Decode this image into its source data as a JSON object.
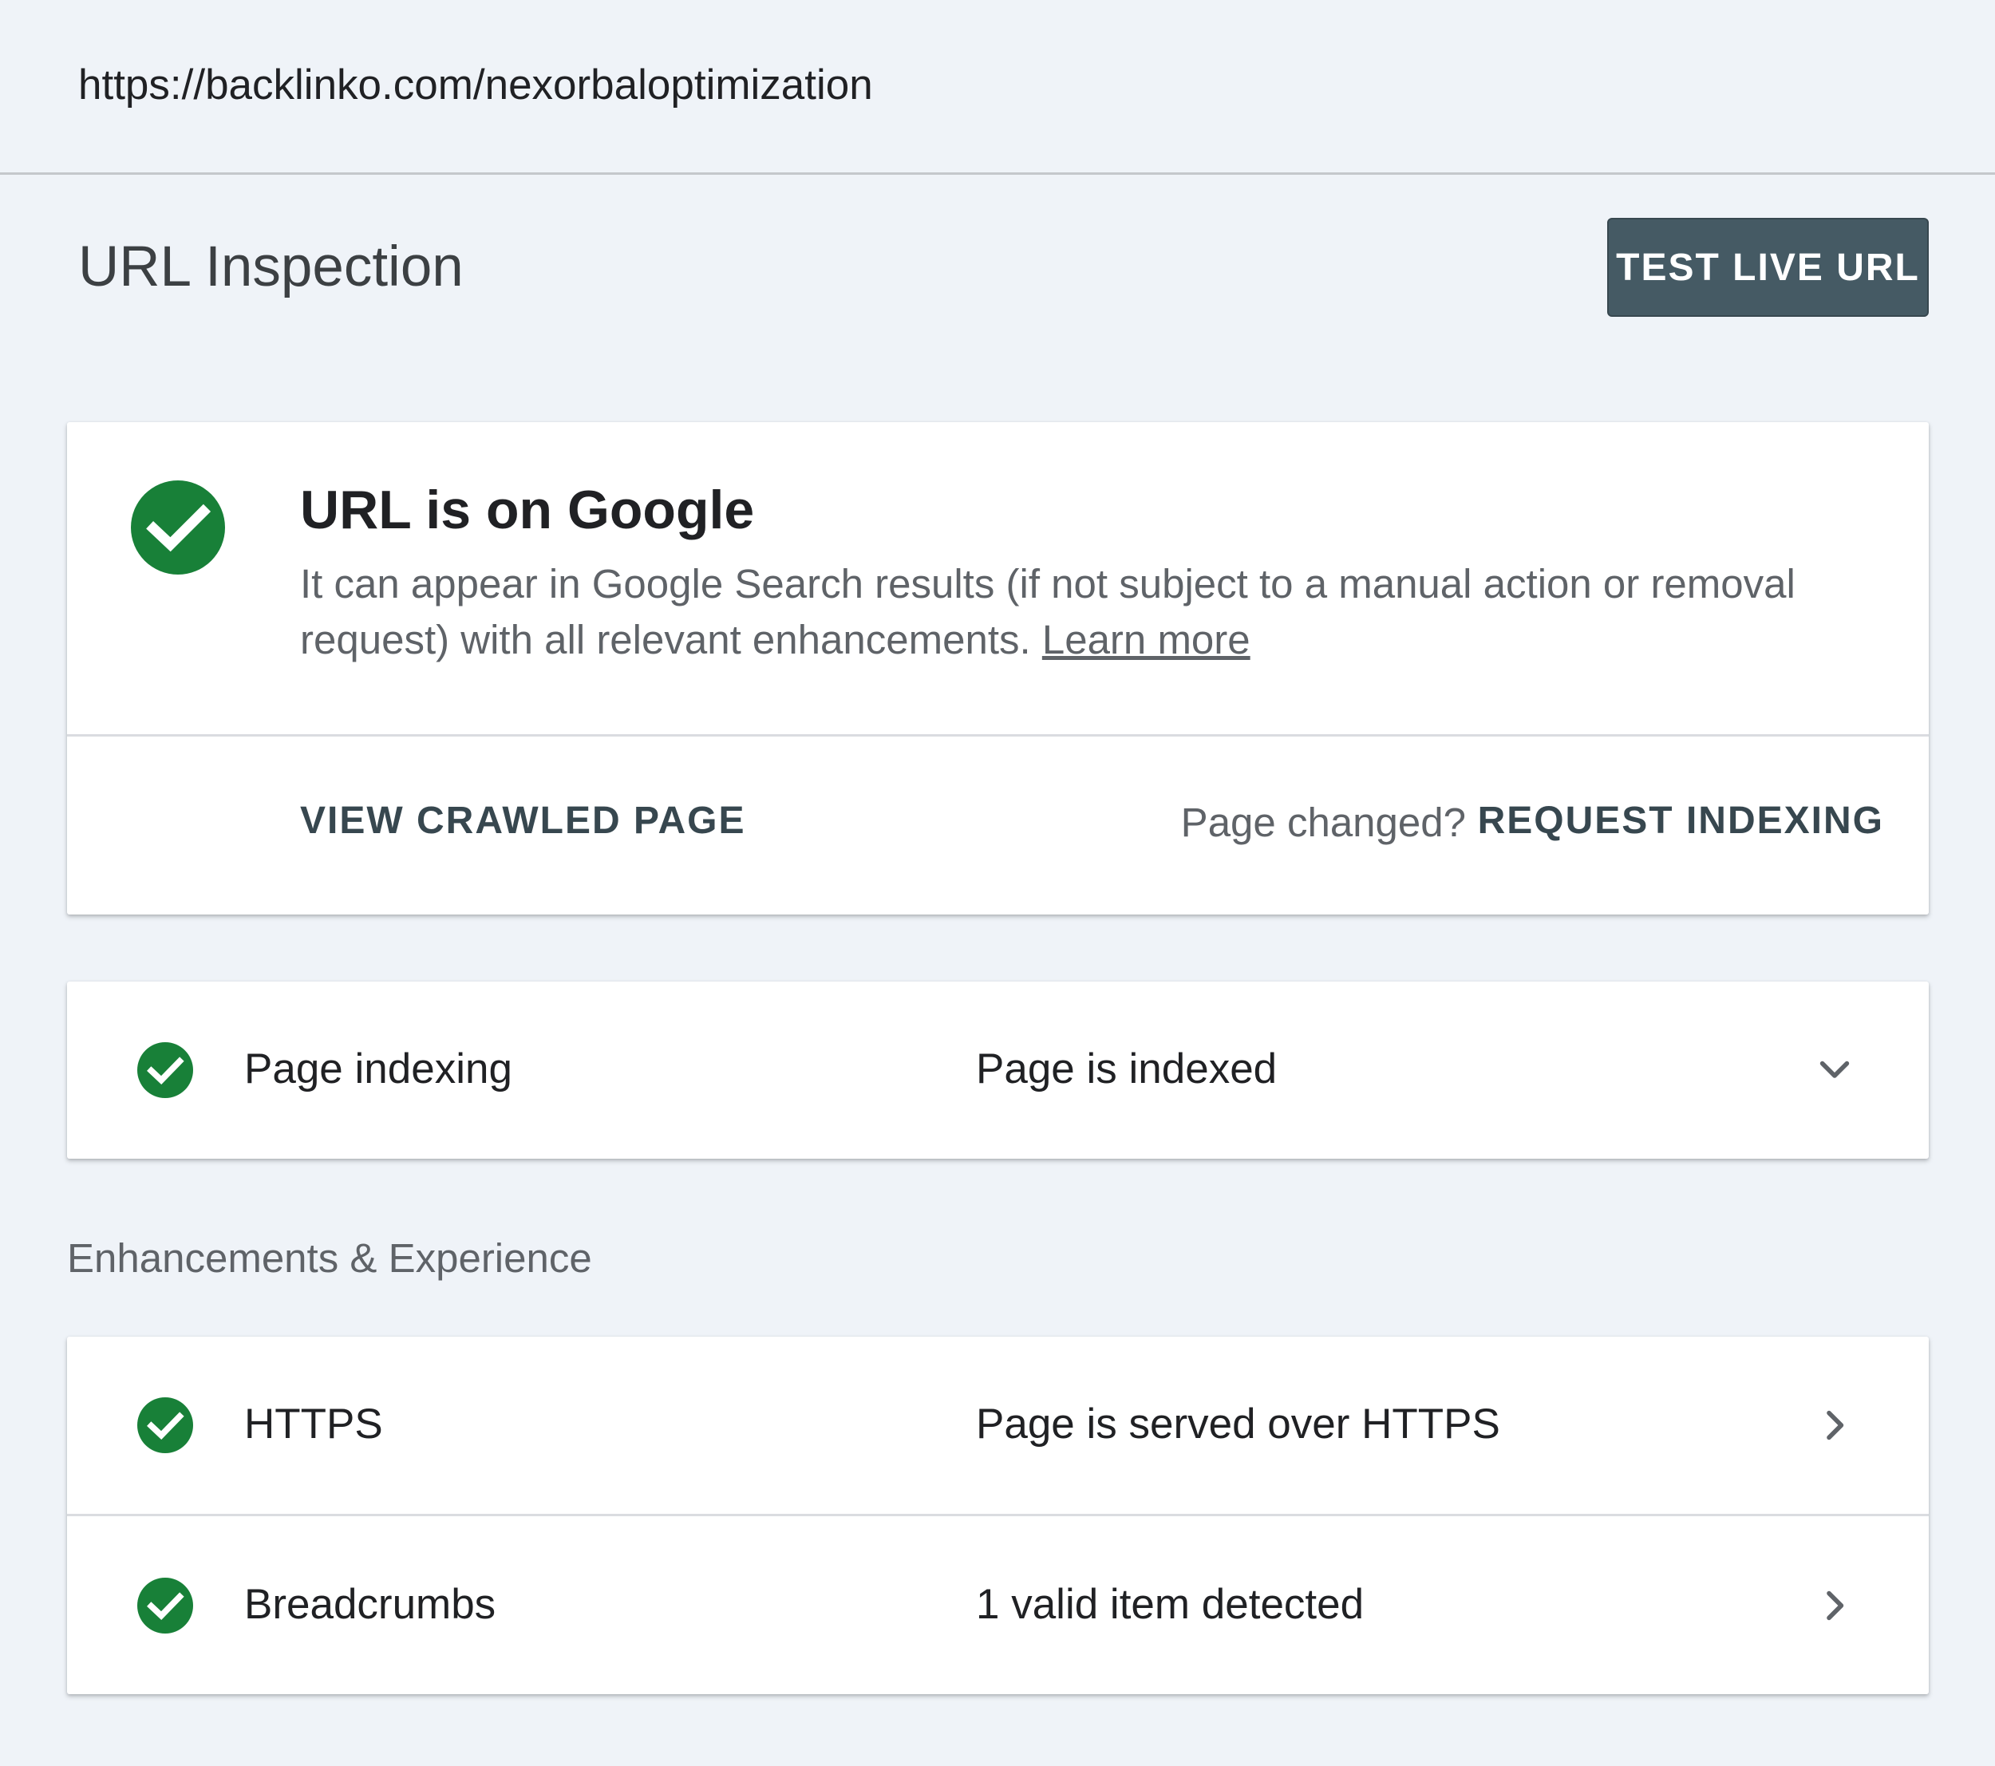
{
  "url_bar": {
    "url": "https://backlinko.com/nexorbaloptimization"
  },
  "header": {
    "title": "URL Inspection",
    "test_live_url_label": "TEST LIVE URL"
  },
  "status_card": {
    "title": "URL is on Google",
    "description": "It can appear in Google Search results (if not subject to a manual action or removal request) with all relevant enhancements.",
    "learn_more_label": "Learn more",
    "view_crawled_label": "VIEW CRAWLED PAGE",
    "page_changed_text": "Page changed?",
    "request_indexing_label": "REQUEST INDEXING",
    "status_icon": "check-circle-icon"
  },
  "indexing": {
    "label": "Page indexing",
    "value": "Page is indexed",
    "icon": "check-circle-icon",
    "toggle_icon": "chevron-down-icon"
  },
  "enhancements": {
    "section_title": "Enhancements & Experience",
    "items": [
      {
        "label": "HTTPS",
        "value": "Page is served over HTTPS",
        "icon": "check-circle-icon",
        "nav_icon": "chevron-right-icon"
      },
      {
        "label": "Breadcrumbs",
        "value": "1 valid item detected",
        "icon": "check-circle-icon",
        "nav_icon": "chevron-right-icon"
      }
    ]
  },
  "colors": {
    "success_green": "#188038",
    "button_dark": "#455a64",
    "background": "#eff3f8"
  }
}
